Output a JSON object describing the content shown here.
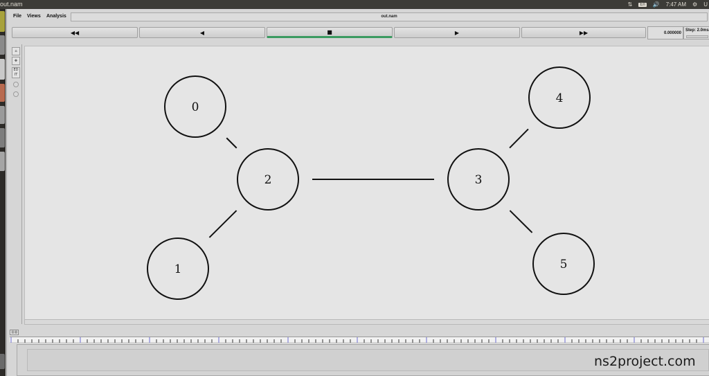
{
  "topbar": {
    "window_title": "out.nam",
    "keyboard_layout": "En",
    "clock": "7:47 AM",
    "user": "U"
  },
  "menu": {
    "items": [
      "File",
      "Views",
      "Analysis"
    ],
    "file_title": "out.nam"
  },
  "controls": {
    "rewind_icon": "fast-rewind-icon",
    "back_icon": "play-backward-icon",
    "stop_icon": "stop-icon",
    "play_icon": "play-icon",
    "forward_icon": "fast-forward-icon",
    "time": "0.000000",
    "step": "Step: 2.0ms"
  },
  "toolbox": {
    "edit_label": "ED IT"
  },
  "topology": {
    "nodes": [
      {
        "id": "0"
      },
      {
        "id": "1"
      },
      {
        "id": "2"
      },
      {
        "id": "3"
      },
      {
        "id": "4"
      },
      {
        "id": "5"
      }
    ],
    "links": [
      [
        "0",
        "2"
      ],
      [
        "1",
        "2"
      ],
      [
        "2",
        "3"
      ],
      [
        "3",
        "4"
      ],
      [
        "3",
        "5"
      ]
    ]
  },
  "colors": {
    "active_accent": "#3a9a60",
    "canvas": "#e5e5e5",
    "node_stroke": "#111111"
  },
  "watermark": "ns2project.com"
}
